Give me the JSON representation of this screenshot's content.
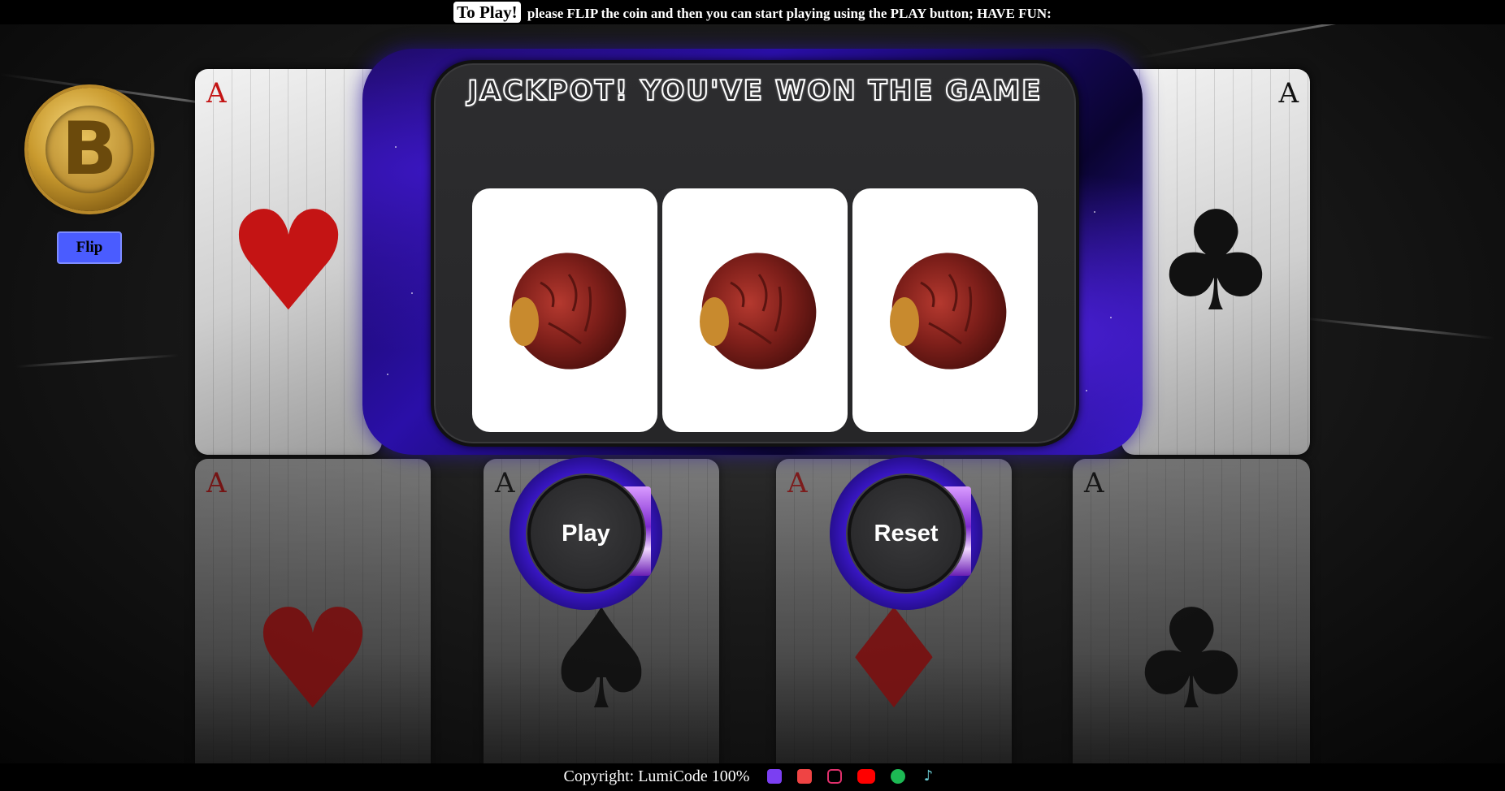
{
  "instructions": {
    "tag": "To Play!",
    "text": "please FLIP the coin and then you can start playing using the PLAY button; HAVE FUN:"
  },
  "coin": {
    "icon": "bitcoin-coin-icon",
    "symbol": "B"
  },
  "flip_label": "Flip",
  "machine": {
    "result_title": "JACKPOT! YOU'VE WON THE GAME",
    "reels": [
      {
        "symbol": "date-fruit-icon"
      },
      {
        "symbol": "date-fruit-icon"
      },
      {
        "symbol": "date-fruit-icon"
      }
    ]
  },
  "controls": {
    "play_label": "Play",
    "reset_label": "Reset"
  },
  "background_cards": [
    {
      "rank": "A",
      "suit": "♥"
    },
    {
      "rank": "A",
      "suit": "♣"
    },
    {
      "rank": "A",
      "suit": "♥"
    },
    {
      "rank": "A",
      "suit": "♠"
    },
    {
      "rank": "A",
      "suit": "♦"
    },
    {
      "rank": "A",
      "suit": "♣"
    }
  ],
  "footer": {
    "copyright": "Copyright: LumiCode 100%",
    "social_icons": [
      {
        "name": "linkedin-icon",
        "color": "#7b3ff2"
      },
      {
        "name": "github-icon",
        "color": "#ef4444"
      },
      {
        "name": "instagram-icon",
        "color": "#e1306c"
      },
      {
        "name": "youtube-icon",
        "color": "#ff0000"
      },
      {
        "name": "spotify-icon",
        "color": "#1db954"
      },
      {
        "name": "tiktok-icon",
        "color": "#69c9d0"
      }
    ]
  },
  "colors": {
    "flip_button": "#4a5cff",
    "machine_glow": "#3a17c8",
    "panel": "#2d2d2f"
  }
}
